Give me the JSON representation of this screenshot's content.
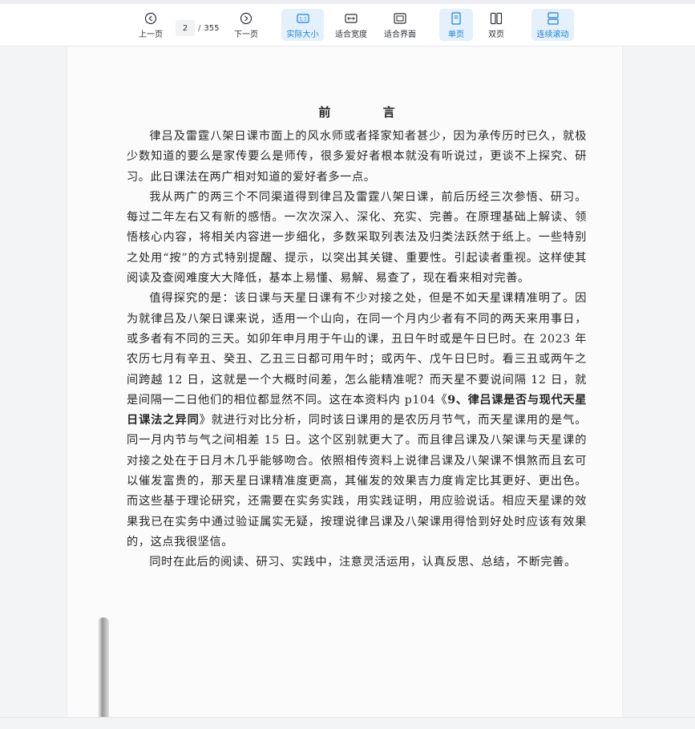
{
  "toolbar": {
    "prev_label": "上一页",
    "next_label": "下一页",
    "page_current": "2",
    "page_separator": "/",
    "page_total": "355",
    "actual_size_label": "实际大小",
    "fit_width_label": "适合宽度",
    "fit_page_label": "适合界面",
    "single_page_label": "单页",
    "double_page_label": "双页",
    "continuous_scroll_label": "连续滚动",
    "accent_color": "#1a7fd9",
    "active_bg_color": "#e4f1fc",
    "icons": {
      "prev": "chevron-left-circle-icon",
      "next": "chevron-right-circle-icon",
      "actual_size": "one-to-one-icon",
      "fit_width": "fit-width-icon",
      "fit_page": "fit-page-icon",
      "single_page": "single-page-icon",
      "double_page": "double-page-icon",
      "continuous_scroll": "continuous-scroll-icon"
    }
  },
  "document": {
    "title": "前 言",
    "p1": "律吕及雷霆八架日课市面上的风水师或者择家知者甚少，因为承传历时已久，就极少数知道的要么是家传要么是师传，很多爱好者根本就没有听说过，更谈不上探究、研习。此日课法在两广相对知道的爱好者多一点。",
    "p2": "我从两广的两三个不同渠道得到律吕及雷霆八架日课，前后历经三次参悟、研习。每过二年左右又有新的感悟。一次次深入、深化、充实、完善。在原理基础上解读、领悟核心内容，将相关内容进一步细化，多数采取列表法及归类法跃然于纸上。一些特别之处用“按”的方式特别提醒、提示，以突出其关键、重要性。引起读者重视。这样使其阅读及查阅难度大大降低，基本上易懂、易解、易查了，现在看来相对完善。",
    "p3_a": "值得探究的是：该日课与天星日课有不少对接之处，但是不如天星课精准明了。因为就律吕及八架日课来说，适用一个山向，在同一个月内少者有不同的两天来用事日，或多者有不同的三天。如卯年申月用于午山的课，丑日午时或是午日巳时。在 2023 年农历七月有辛丑、癸丑、乙丑三日都可用午时；或丙午、戊午日巳时。看三丑或两午之间跨越 12 日，这就是一个大概时间差，怎么能精准呢？而天星不要说间隔 12 日，就是间隔一二日他们的相位都显然不同。这在本资料内 p104《",
    "p3_bold": "9、律吕课是否与现代天星日课法之异同",
    "p3_b": "》就进行对比分析，同时该日课用的是农历月节气，而天星课用的是气。同一月内节与气之间相差 15 日。这个区别就更大了。而且律吕课及八架课与天星课的对接之处在于日月木几乎能够吻合。依照相传资料上说律吕课及八架课不惧煞而且玄可以催发富贵的，那天星日课精准度更高，其催发的效果吉力度肯定比其更好、更出色。而这些基于理论研究，还需要在实务实践，用实践证明，用应验说话。相应天星课的效果我已在实务中通过验证属实无疑，按理说律吕课及八架课用得恰到好处时应该有效果的，这点我很坚信。",
    "p4": "同时在此后的阅读、研习、实践中，注意灵活运用，认真反思、总结，不断完善。"
  }
}
